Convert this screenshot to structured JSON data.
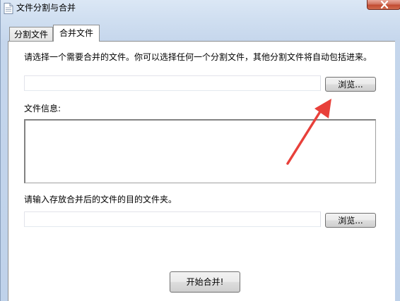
{
  "window": {
    "title": "文件分割与合并"
  },
  "tabs": [
    {
      "label": "分割文件"
    },
    {
      "label": "合并文件"
    }
  ],
  "merge": {
    "instruction": "请选择一个需要合并的文件。你可以选择任何一个分割文件，其他分割文件将自动包括进来。",
    "source_file_value": "",
    "browse_label": "浏览...",
    "file_info_label": "文件信息:",
    "file_info_value": "",
    "dest_instruction": "请输入存放合并后的文件的目的文件夹。",
    "dest_folder_value": "",
    "dest_browse_label": "浏览...",
    "start_label": "开始合并!"
  },
  "colors": {
    "annotation_arrow": "#e8403a",
    "close_button": "#c84b32"
  }
}
